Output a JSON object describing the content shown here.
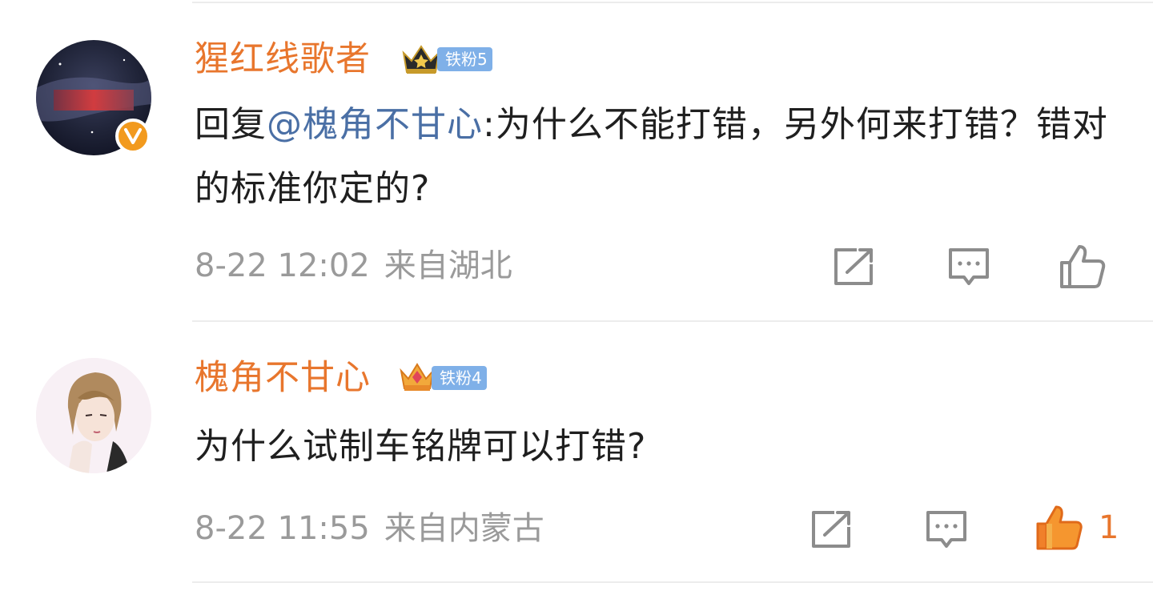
{
  "comments": [
    {
      "username": "猩红线歌者",
      "fan_badge": "铁粉5",
      "verified": true,
      "reply_prefix": "回复",
      "mention": "@槐角不甘心",
      "text": ":为什么不能打错，另外何来打错？错对的标准你定的?",
      "date": "8-22 12:02",
      "location": "来自湖北",
      "icons": [
        "share-icon",
        "comment-icon",
        "like-icon"
      ],
      "like_count": ""
    },
    {
      "username": "槐角不甘心",
      "fan_badge": "铁粉4",
      "verified": false,
      "text": "为什么试制车铭牌可以打错?",
      "date": "8-22 11:55",
      "location": "来自内蒙古",
      "icons": [
        "share-icon",
        "comment-icon",
        "like-icon-active"
      ],
      "like_count": "1"
    }
  ],
  "colors": {
    "username": "#e8762d",
    "mention": "#4a6fa5",
    "meta": "#9a9a9a",
    "liked": "#f0802a",
    "badge": "#7fb0e8"
  }
}
